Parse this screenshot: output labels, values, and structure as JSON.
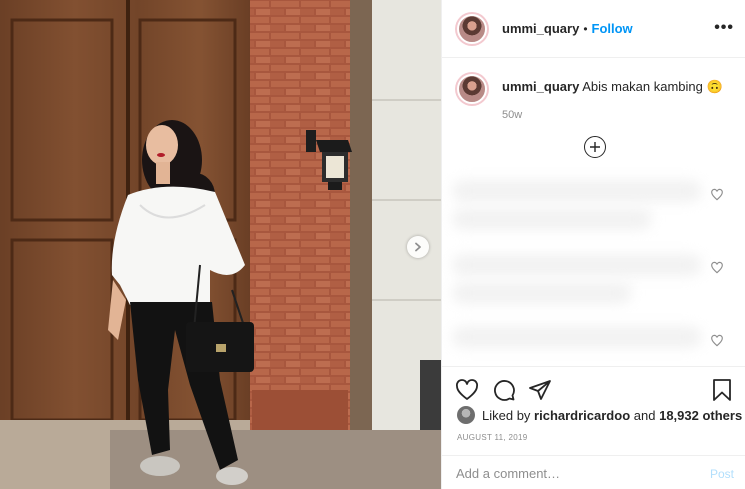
{
  "post": {
    "username": "ummi_quary",
    "separator": "•",
    "follow_label": "Follow",
    "more_label": "•••",
    "caption_user": "ummi_quary",
    "caption_text": "Abis makan kambing 🙃",
    "caption_time": "50w",
    "likes_prefix": "Liked by",
    "likes_user": "richardricardoo",
    "likes_and": "and",
    "likes_count": "18,932 others",
    "date": "AUGUST 11, 2019"
  },
  "comment_box": {
    "placeholder": "Add a comment…",
    "post_label": "Post"
  },
  "icons": {
    "actions": [
      "heart-icon",
      "comment-icon",
      "share-icon",
      "bookmark-icon"
    ],
    "load_more": "plus-circle-icon",
    "carousel": "chevron-right-icon"
  },
  "colors": {
    "accent": "#0095f6",
    "post_disabled": "#b2dffc",
    "muted": "#8e8e8e",
    "text": "#262626"
  }
}
